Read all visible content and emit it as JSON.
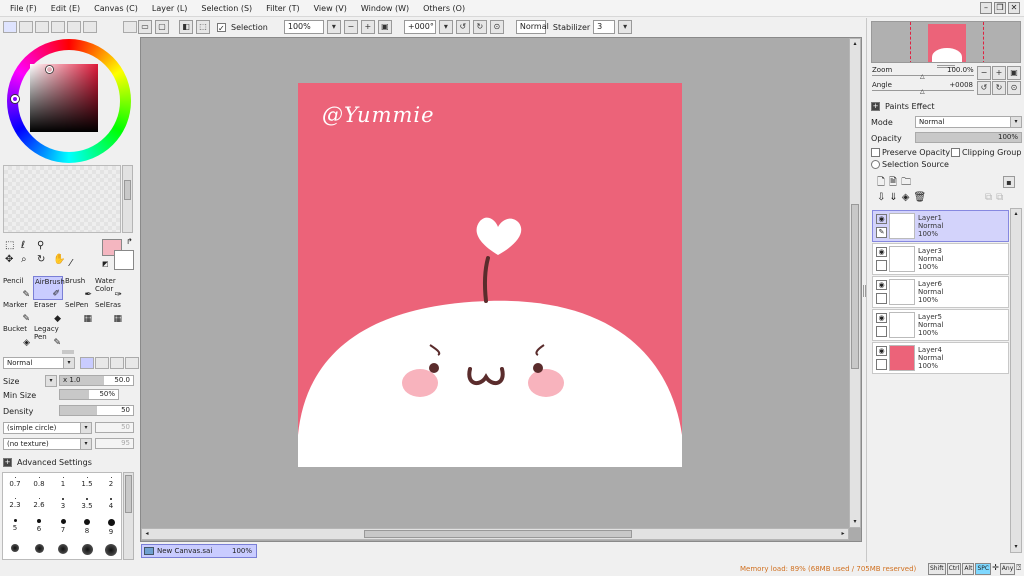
{
  "menu": [
    "File (F)",
    "Edit (E)",
    "Canvas (C)",
    "Layer (L)",
    "Selection (S)",
    "Filter (T)",
    "View (V)",
    "Window (W)",
    "Others (O)"
  ],
  "toolbar": {
    "selection_label": "Selection",
    "zoom": "100%",
    "angle": "+000°",
    "mode": "Normal",
    "stabilizer_label": "Stabilizer",
    "stabilizer_value": "3"
  },
  "tools": [
    {
      "label": "Pencil"
    },
    {
      "label": "AirBrush"
    },
    {
      "label": "Brush"
    },
    {
      "label": "Water Color"
    },
    {
      "label": "Marker"
    },
    {
      "label": "Eraser"
    },
    {
      "label": "SelPen"
    },
    {
      "label": "SelEras"
    },
    {
      "label": "Bucket"
    },
    {
      "label": "Legacy Pen"
    }
  ],
  "brush": {
    "blend_mode": "Normal",
    "size_label": "Size",
    "size_multiplier": "x 1.0",
    "size_value": "50.0",
    "min_size_label": "Min Size",
    "min_size_value": "50%",
    "density_label": "Density",
    "density_value": "50",
    "shape": "(simple circle)",
    "shape_value": "50",
    "texture": "(no texture)",
    "texture_value": "95",
    "advanced_label": "Advanced Settings"
  },
  "brush_sizes": [
    [
      "0.7",
      "0.8",
      "1",
      "1.5",
      "2"
    ],
    [
      "2.3",
      "2.6",
      "3",
      "3.5",
      "4"
    ],
    [
      "5",
      "6",
      "7",
      "8",
      "9"
    ]
  ],
  "artwork": {
    "watermark": "@Yummie",
    "bg_color": "#ec6379",
    "blush_color": "#f7a6b2",
    "face_color": "#5a2c2c"
  },
  "right": {
    "zoom_label": "Zoom",
    "zoom_value": "100.0%",
    "angle_label": "Angle",
    "angle_value": "+0008",
    "paints_effect_label": "Paints Effect",
    "mode_label": "Mode",
    "mode_value": "Normal",
    "opacity_label": "Opacity",
    "opacity_value": "100%",
    "preserve_opacity_label": "Preserve Opacity",
    "clipping_group_label": "Clipping Group",
    "selection_source_label": "Selection Source"
  },
  "layers": [
    {
      "name": "Layer1",
      "mode": "Normal",
      "opacity": "100%",
      "selected": true
    },
    {
      "name": "Layer3",
      "mode": "Normal",
      "opacity": "100%",
      "selected": false
    },
    {
      "name": "Layer6",
      "mode": "Normal",
      "opacity": "100%",
      "selected": false
    },
    {
      "name": "Layer5",
      "mode": "Normal",
      "opacity": "100%",
      "selected": false
    },
    {
      "name": "Layer4",
      "mode": "Normal",
      "opacity": "100%",
      "selected": false
    }
  ],
  "document_tab": {
    "name": "New Canvas.sai",
    "zoom": "100%"
  },
  "status": {
    "memory": "Memory load: 89% (68MB used / 705MB reserved)",
    "keys": [
      "Shift",
      "Ctrl",
      "Alt",
      "SPC",
      "Any"
    ]
  },
  "colors": {
    "main_color": "#f4b6c0",
    "sub_color": "#ffffff",
    "selected_tool": "#c9ccff"
  }
}
